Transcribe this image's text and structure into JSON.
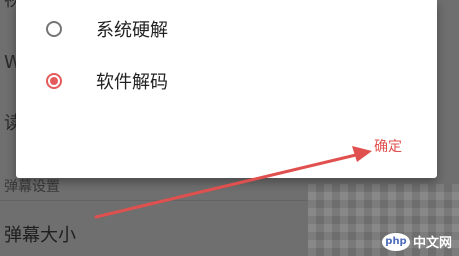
{
  "background": {
    "rows": [
      "视",
      "W",
      "读"
    ],
    "section_label": "弹幕设置",
    "item_label": "弹幕大小"
  },
  "dialog": {
    "options": [
      {
        "label": "系统硬解",
        "selected": false
      },
      {
        "label": "软件解码",
        "selected": true
      }
    ],
    "confirm_label": "确定"
  },
  "watermark": {
    "logo": "php",
    "text": "中文网"
  },
  "colors": {
    "accent": "#e55b5b",
    "arrow": "#e0504e"
  }
}
